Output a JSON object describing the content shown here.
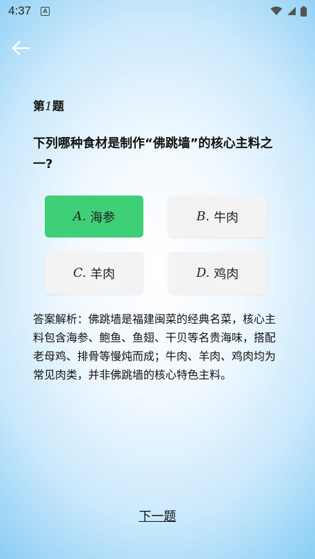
{
  "status_bar": {
    "time": "4:37",
    "notification_icon": "a-icon",
    "icons": [
      "wifi-icon",
      "signal-icon",
      "battery-icon"
    ]
  },
  "nav": {
    "back_icon": "arrow-left-icon"
  },
  "question": {
    "prefix": "第",
    "number": "1",
    "suffix": "题",
    "text": "下列哪种食材是制作“佛跳墙”的核心主料之一?"
  },
  "options": [
    {
      "letter": "A.",
      "label": "海参",
      "selected": true
    },
    {
      "letter": "B.",
      "label": "牛肉",
      "selected": false
    },
    {
      "letter": "C.",
      "label": "羊肉",
      "selected": false
    },
    {
      "letter": "D.",
      "label": "鸡肉",
      "selected": false
    }
  ],
  "analysis": "答案解析：佛跳墙是福建闽菜的经典名菜，核心主料包含海参、鲍鱼、鱼翅、干贝等名贵海味，搭配老母鸡、排骨等慢炖而成；牛肉、羊肉、鸡肉均为常见肉类，并非佛跳墙的核心特色主料。",
  "next_label": "下一题",
  "colors": {
    "selected_option": "#3ecf77",
    "option_bg": "#f3f3f3",
    "background_edge": "#8ecff5"
  }
}
